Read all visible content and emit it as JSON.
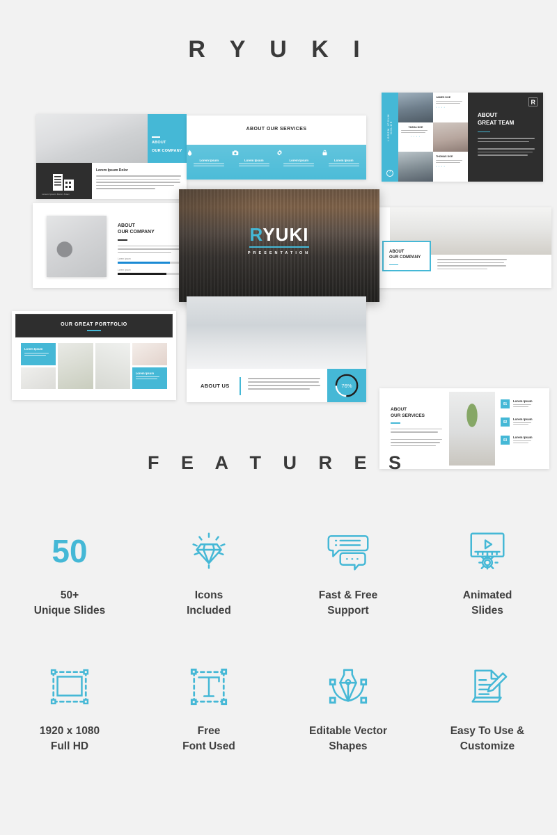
{
  "brand": {
    "title": "R Y U K I"
  },
  "features_section": {
    "title": "F E A T U R E S"
  },
  "features": [
    {
      "icon": "number-50",
      "value": "50",
      "label": "50+\nUnique Slides"
    },
    {
      "icon": "diamond-icon",
      "value": "",
      "label": "Icons\nIncluded"
    },
    {
      "icon": "chat-bubbles-icon",
      "value": "",
      "label": "Fast & Free\nSupport"
    },
    {
      "icon": "animation-gear-icon",
      "value": "",
      "label": "Animated\nSlides"
    },
    {
      "icon": "crop-frame-icon",
      "value": "",
      "label": "1920 x 1080\nFull HD"
    },
    {
      "icon": "text-tool-icon",
      "value": "",
      "label": "Free\nFont Used"
    },
    {
      "icon": "pen-tool-icon",
      "value": "",
      "label": "Editable Vector\nShapes"
    },
    {
      "icon": "document-pencil-icon",
      "value": "",
      "label": "Easy To Use &\nCustomize"
    }
  ],
  "colors": {
    "accent": "#45b8d6",
    "dark": "#2e2e2e",
    "background": "#f2f2f2",
    "text": "#3f3f3f"
  },
  "slides": {
    "company_intro": {
      "heading_line1": "ABOUT",
      "heading_line2": "OUR COMPANY",
      "body_heading": "Lorem Ipsum Dolor",
      "icon_caption": "Lorem Ipsum Dolor Amet"
    },
    "services_icons": {
      "title": "ABOUT OUR SERVICES",
      "columns": [
        {
          "icon": "drop-icon",
          "label": "Lorem Ipsum"
        },
        {
          "icon": "camera-icon",
          "label": "Lorem Ipsum"
        },
        {
          "icon": "gear-icon",
          "label": "Lorem Ipsum"
        },
        {
          "icon": "lock-icon",
          "label": "Lorem Ipsum"
        }
      ]
    },
    "great_team": {
      "heading_line1": "ABOUT",
      "heading_line2": "GREAT TEAM",
      "rail_text": "LOREM IPSUM DOLOR",
      "logo": "R",
      "members": [
        {
          "name": "JAMES DOE"
        },
        {
          "name": "TASHA DOE"
        },
        {
          "name": "THOMAS DOE"
        }
      ]
    },
    "company_stats": {
      "heading_line1": "ABOUT",
      "heading_line2": "OUR COMPANY",
      "bars": [
        {
          "label": "Lorem Ipsum",
          "percent": 82,
          "color": "#1a8ad4"
        },
        {
          "label": "Lorem Ipsum",
          "percent": 76,
          "color": "#1d1d1d"
        }
      ]
    },
    "company_room": {
      "heading_line1": "ABOUT",
      "heading_line2": "OUR COMPANY"
    },
    "title_hero": {
      "logo_initial": "R",
      "logo_rest": "YUKI",
      "subtitle": "PRESENTATION"
    },
    "portfolio": {
      "title": "OUR GREAT PORTFOLIO",
      "tiles": [
        {
          "type": "cyan",
          "heading": "Lorem Ipsum"
        },
        {
          "type": "photo"
        },
        {
          "type": "photo"
        },
        {
          "type": "photo"
        },
        {
          "type": "photo"
        },
        {
          "type": "cyan",
          "heading": "Lorem Ipsum"
        }
      ]
    },
    "about_us": {
      "title": "ABOUT US",
      "stat_value": "76%",
      "stat_percent": 76
    },
    "services_list": {
      "heading_line1": "ABOUT",
      "heading_line2": "OUR SERVICES",
      "items": [
        {
          "number": "01",
          "heading": "Lorem Ipsum"
        },
        {
          "number": "02",
          "heading": "Lorem Ipsum"
        },
        {
          "number": "03",
          "heading": "Lorem Ipsum"
        }
      ]
    }
  }
}
